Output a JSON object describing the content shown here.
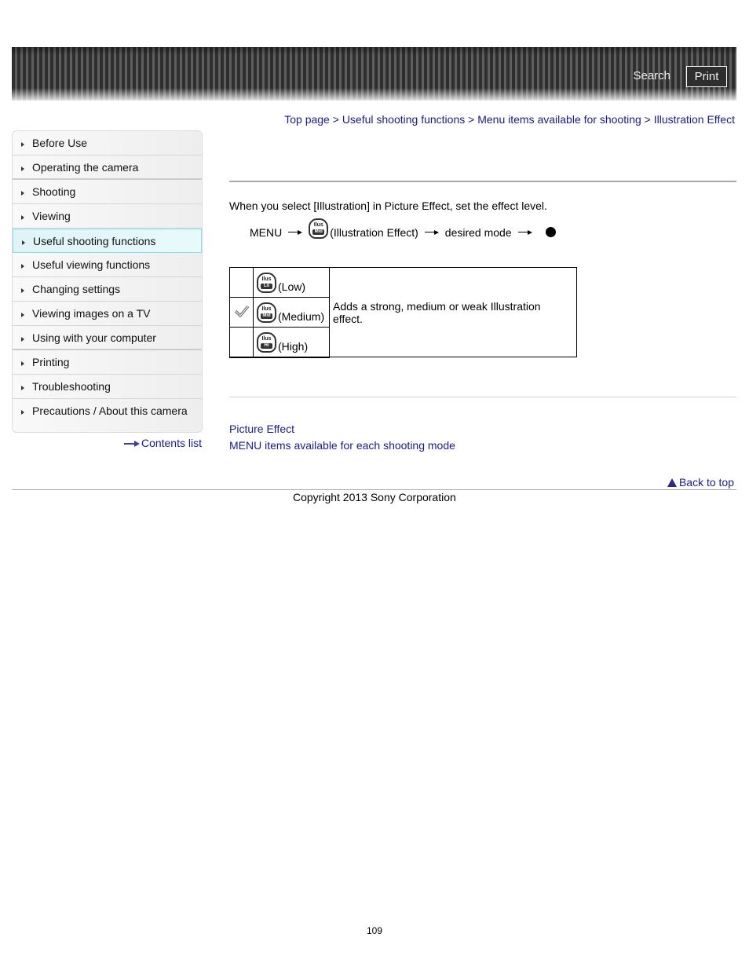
{
  "header": {
    "search_label": "Search",
    "print_label": "Print"
  },
  "breadcrumb": {
    "items": [
      "Top page",
      "Useful shooting functions",
      "Menu items available for shooting",
      "Illustration Effect"
    ],
    "separator": ">"
  },
  "sidebar": {
    "items": [
      {
        "label": "Before Use",
        "active": false
      },
      {
        "label": "Operating the camera",
        "active": false
      },
      {
        "label": "Shooting",
        "active": false
      },
      {
        "label": "Viewing",
        "active": false
      },
      {
        "label": "Useful shooting functions",
        "active": true
      },
      {
        "label": "Useful viewing functions",
        "active": false
      },
      {
        "label": "Changing settings",
        "active": false
      },
      {
        "label": "Viewing images on a TV",
        "active": false
      },
      {
        "label": "Using with your computer",
        "active": false
      },
      {
        "label": "Printing",
        "active": false
      },
      {
        "label": "Troubleshooting",
        "active": false
      },
      {
        "label": "Precautions / About this camera",
        "active": false
      }
    ],
    "contents_list_label": "Contents list"
  },
  "main": {
    "intro": "When you select [Illustration] in Picture Effect, set the effect level.",
    "menu_path": {
      "menu": "MENU",
      "icon": "illustration-effect-icon",
      "icon_text": "Ilus",
      "icon_level": "Mid",
      "setting": "(Illustration Effect)",
      "step": "desired mode",
      "confirm_icon": "center-button-dot-icon"
    },
    "modes_table": {
      "rows": [
        {
          "selected": false,
          "icon_text": "Ilus",
          "icon_level": "Lo",
          "label": "(Low)"
        },
        {
          "selected": true,
          "icon_text": "Ilus",
          "icon_level": "Mid",
          "label": "(Medium)"
        },
        {
          "selected": false,
          "icon_text": "Ilus",
          "icon_level": "Hi",
          "label": "(High)"
        }
      ],
      "description": "Adds a strong, medium or weak Illustration effect."
    },
    "related_links": [
      "Picture Effect",
      "MENU items available for each shooting mode"
    ]
  },
  "footer": {
    "back_to_top": "Back to top",
    "copyright": "Copyright 2013 Sony Corporation",
    "page_number": "109"
  }
}
